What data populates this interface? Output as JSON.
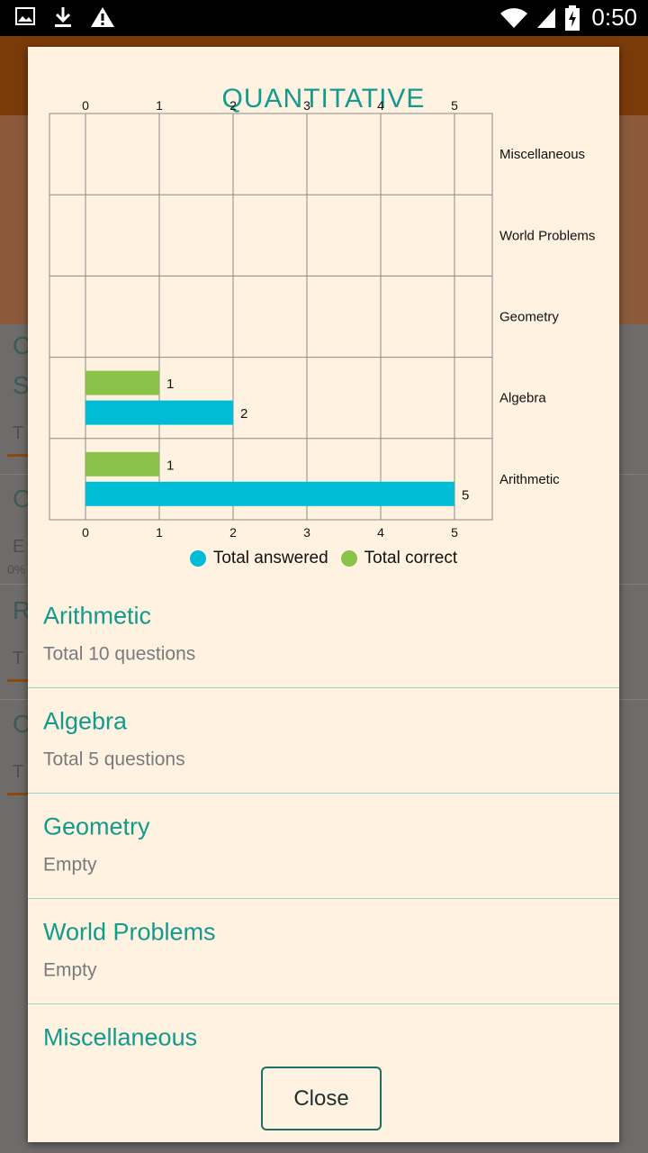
{
  "status_bar": {
    "time": "0:50",
    "icons": [
      "image-icon",
      "download-icon",
      "warning-icon",
      "wifi-icon",
      "signal-icon",
      "battery-charging-icon"
    ]
  },
  "dialog": {
    "title": "QUANTITATIVE",
    "close_label": "Close",
    "accent_color": "#139a8e",
    "categories": [
      {
        "name": "Arithmetic",
        "subtitle": "Total 10 questions"
      },
      {
        "name": "Algebra",
        "subtitle": "Total 5 questions"
      },
      {
        "name": "Geometry",
        "subtitle": "Empty"
      },
      {
        "name": "World Problems",
        "subtitle": "Empty"
      },
      {
        "name": "Miscellaneous",
        "subtitle": ""
      }
    ]
  },
  "chart_data": {
    "type": "bar",
    "orientation": "horizontal",
    "categories": [
      "Miscellaneous",
      "World Problems",
      "Geometry",
      "Algebra",
      "Arithmetic"
    ],
    "series": [
      {
        "name": "Total correct",
        "color": "#8bc34a",
        "values": [
          0,
          0,
          0,
          1,
          1
        ]
      },
      {
        "name": "Total answered",
        "color": "#00bcd4",
        "values": [
          0,
          0,
          0,
          2,
          5
        ]
      }
    ],
    "xlim": [
      0,
      5
    ],
    "x_ticks": [
      "0",
      "1",
      "2",
      "3",
      "4",
      "5"
    ],
    "grid": true,
    "legend": "bottom",
    "legend_entries": [
      "Total answered",
      "Total correct"
    ]
  }
}
